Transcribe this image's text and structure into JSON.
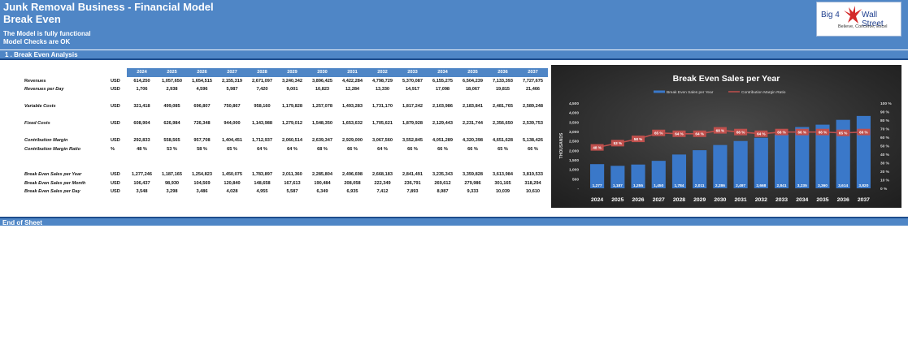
{
  "header": {
    "title": "Junk Removal Business - Financial Model",
    "subtitle": "Break Even",
    "note1": "The Model is fully functional",
    "note2": "Model Checks are OK",
    "logo_big": "Big 4",
    "logo_wall": "Wall Street",
    "logo_tag": "Believe, Conceive, Excel"
  },
  "section": {
    "label": "1 .  Break Even Analysis"
  },
  "footer": {
    "label": "End of Sheet"
  },
  "table": {
    "years": [
      "2024",
      "2025",
      "2026",
      "2027",
      "2028",
      "2029",
      "2030",
      "2031",
      "2032",
      "2033",
      "2034",
      "2035",
      "2036",
      "2037"
    ],
    "rows": [
      {
        "label": "Revenues",
        "italic": false,
        "unit": "USD",
        "values": [
          "614,250",
          "1,057,650",
          "1,654,515",
          "2,155,319",
          "2,671,097",
          "3,240,342",
          "3,896,425",
          "4,422,284",
          "4,798,729",
          "5,370,087",
          "6,155,275",
          "6,504,239",
          "7,133,393",
          "7,727,675"
        ]
      },
      {
        "label": "Revenues per Day",
        "italic": true,
        "unit": "USD",
        "values": [
          "1,706",
          "2,938",
          "4,596",
          "5,987",
          "7,420",
          "9,001",
          "10,823",
          "12,284",
          "13,330",
          "14,917",
          "17,098",
          "18,067",
          "19,815",
          "21,466"
        ]
      },
      {
        "label": "",
        "gap": true
      },
      {
        "label": "Variable Costs",
        "italic": true,
        "unit": "USD",
        "values": [
          "321,418",
          "499,085",
          "696,807",
          "750,867",
          "958,160",
          "1,179,828",
          "1,257,078",
          "1,493,283",
          "1,731,170",
          "1,817,242",
          "2,103,986",
          "2,183,841",
          "2,481,765",
          "2,589,248"
        ]
      },
      {
        "label": "",
        "gap": true
      },
      {
        "label": "Fixed Costs",
        "italic": true,
        "unit": "USD",
        "values": [
          "608,904",
          "626,984",
          "726,348",
          "944,000",
          "1,143,988",
          "1,279,012",
          "1,548,350",
          "1,653,632",
          "1,705,621",
          "1,879,928",
          "2,129,443",
          "2,231,744",
          "2,356,650",
          "2,539,753"
        ]
      },
      {
        "label": "",
        "gap": true
      },
      {
        "label": "Contribution Margin",
        "italic": true,
        "unit": "USD",
        "values": [
          "292,833",
          "558,565",
          "957,708",
          "1,404,451",
          "1,712,937",
          "2,060,514",
          "2,639,347",
          "2,929,000",
          "3,067,560",
          "3,552,845",
          "4,051,289",
          "4,320,398",
          "4,651,628",
          "5,138,426"
        ]
      },
      {
        "label": "Contribution Margin Ratio",
        "italic": true,
        "unit": "%",
        "values": [
          "48 %",
          "53 %",
          "58 %",
          "65 %",
          "64 %",
          "64 %",
          "68 %",
          "66 %",
          "64 %",
          "66 %",
          "66 %",
          "66 %",
          "65 %",
          "66 %"
        ]
      },
      {
        "label": "",
        "gap": true
      },
      {
        "label": "",
        "gap": true
      },
      {
        "label": "Break Even Sales per Year",
        "italic": true,
        "unit": "USD",
        "values": [
          "1,277,246",
          "1,187,165",
          "1,254,823",
          "1,450,075",
          "1,783,897",
          "2,011,360",
          "2,285,804",
          "2,496,698",
          "2,668,183",
          "2,841,491",
          "3,235,343",
          "3,359,828",
          "3,613,984",
          "3,819,533"
        ]
      },
      {
        "label": "Break Even Sales per Month",
        "italic": true,
        "unit": "USD",
        "values": [
          "106,437",
          "98,930",
          "104,569",
          "120,840",
          "148,658",
          "167,613",
          "190,484",
          "208,058",
          "222,349",
          "236,791",
          "269,612",
          "279,986",
          "301,165",
          "318,294"
        ]
      },
      {
        "label": "Break Even Sales per Day",
        "italic": true,
        "unit": "USD",
        "values": [
          "3,548",
          "3,298",
          "3,486",
          "4,028",
          "4,955",
          "5,587",
          "6,349",
          "6,935",
          "7,412",
          "7,893",
          "8,987",
          "9,333",
          "10,039",
          "10,610"
        ]
      }
    ]
  },
  "chart_data": {
    "type": "bar",
    "title": "Break Even Sales per Year",
    "ylabel": "THOUSANDS",
    "categories": [
      "2024",
      "2025",
      "2026",
      "2027",
      "2028",
      "2029",
      "2030",
      "2031",
      "2032",
      "2033",
      "2034",
      "2035",
      "2036",
      "2037"
    ],
    "series": [
      {
        "name": "Break Even Sales per Year",
        "type": "bar",
        "axis": "left",
        "color": "#3a78c9",
        "values": [
          1277,
          1187,
          1255,
          1450,
          1784,
          2011,
          2286,
          2497,
          2668,
          2841,
          3235,
          3360,
          3614,
          3820
        ],
        "labels": [
          "1,277",
          "1,187",
          "1,255",
          "1,450",
          "1,784",
          "2,011",
          "2,286",
          "2,497",
          "2,668",
          "2,841",
          "3,235",
          "3,360",
          "3,614",
          "3,820"
        ]
      },
      {
        "name": "Contribution Margin Ratio",
        "type": "line",
        "axis": "right",
        "color": "#c0504d",
        "values": [
          48,
          53,
          58,
          65,
          64,
          64,
          68,
          66,
          64,
          66,
          66,
          66,
          65,
          66
        ],
        "labels": [
          "48 %",
          "53 %",
          "58 %",
          "65 %",
          "64 %",
          "64 %",
          "68 %",
          "66 %",
          "64 %",
          "66 %",
          "66 %",
          "66 %",
          "65 %",
          "66 %"
        ]
      }
    ],
    "ylim": [
      0,
      4500
    ],
    "y_ticks": [
      "-",
      "500",
      "1,000",
      "1,500",
      "2,000",
      "2,500",
      "3,000",
      "3,500",
      "4,000",
      "4,500"
    ],
    "y2lim": [
      0,
      100
    ],
    "y2_ticks": [
      "0 %",
      "10 %",
      "20 %",
      "30 %",
      "40 %",
      "50 %",
      "60 %",
      "70 %",
      "80 %",
      "90 %",
      "100 %"
    ],
    "legend": "top-center",
    "grid": false
  }
}
